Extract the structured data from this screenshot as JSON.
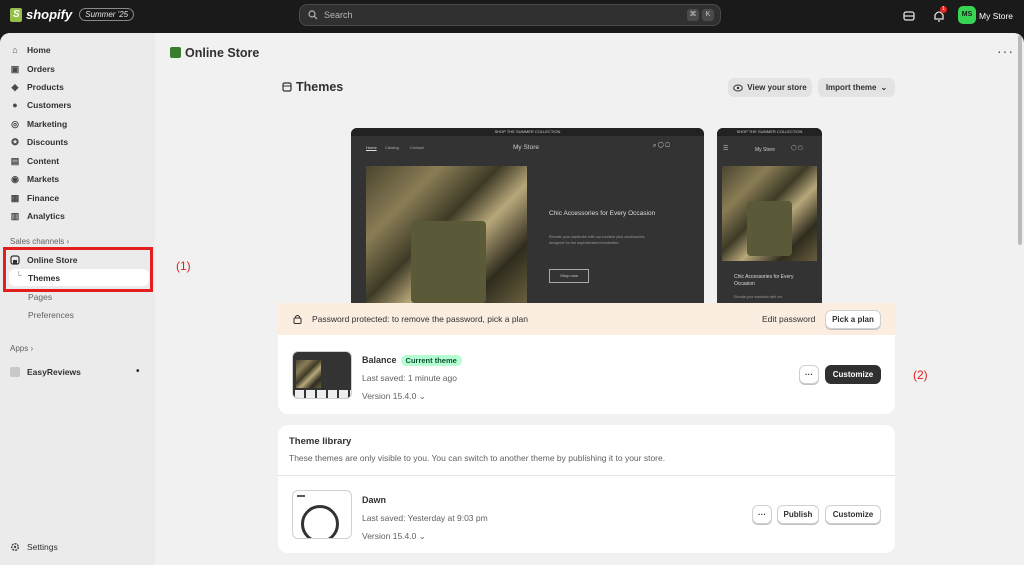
{
  "topbar": {
    "logo_text": "shopify",
    "badge": "Summer '25",
    "search_placeholder": "Search",
    "kbd1": "⌘",
    "kbd2": "K",
    "notif_count": "1",
    "avatar_initials": "MS",
    "store_name": "My Store"
  },
  "sidebar": {
    "items": [
      {
        "label": "Home",
        "icon": "home-icon"
      },
      {
        "label": "Orders",
        "icon": "orders-icon"
      },
      {
        "label": "Products",
        "icon": "tag-icon"
      },
      {
        "label": "Customers",
        "icon": "person-icon"
      },
      {
        "label": "Marketing",
        "icon": "target-icon"
      },
      {
        "label": "Discounts",
        "icon": "discount-icon"
      },
      {
        "label": "Content",
        "icon": "content-icon"
      },
      {
        "label": "Markets",
        "icon": "globe-icon"
      },
      {
        "label": "Finance",
        "icon": "bank-icon"
      },
      {
        "label": "Analytics",
        "icon": "chart-icon"
      }
    ],
    "sales_channels_label": "Sales channels",
    "online_store_label": "Online Store",
    "sub_items": [
      "Themes",
      "Pages",
      "Preferences"
    ],
    "apps_label": "Apps",
    "app_item": "EasyReviews",
    "settings_label": "Settings"
  },
  "annotations": {
    "one": "(1)",
    "two": "(2)"
  },
  "page": {
    "title": "Online Store",
    "themes_title": "Themes",
    "view_store_label": "View your store",
    "import_theme_label": "Import theme"
  },
  "preview": {
    "announcement": "SHOP THE SUMMER COLLECTION",
    "nav_home": "Home",
    "nav_catalog": "Catalog",
    "nav_contact": "Contact",
    "store_title": "My Store",
    "hero_title": "Chic Accessories for Every Occasion",
    "hero_body": "Elevate your wardrobe with our modern pink accessories, designed for the sophisticated trendsetter.",
    "hero_button": "Shop now",
    "mobile_body": "Elevate your wardrobe with our"
  },
  "password_bar": {
    "text": "Password protected: to remove the password, pick a plan",
    "edit_label": "Edit password",
    "plan_label": "Pick a plan"
  },
  "current_theme": {
    "name": "Balance",
    "badge": "Current theme",
    "saved": "Last saved: 1 minute ago",
    "version": "Version 15.4.0",
    "more_label": "···",
    "customize_label": "Customize"
  },
  "library": {
    "title": "Theme library",
    "subtitle": "These themes are only visible to you. You can switch to another theme by publishing it to your store.",
    "theme_name": "Dawn",
    "saved": "Last saved: Yesterday at 9:03 pm",
    "version": "Version 15.4.0",
    "more_label": "···",
    "publish_label": "Publish",
    "customize_label": "Customize"
  }
}
